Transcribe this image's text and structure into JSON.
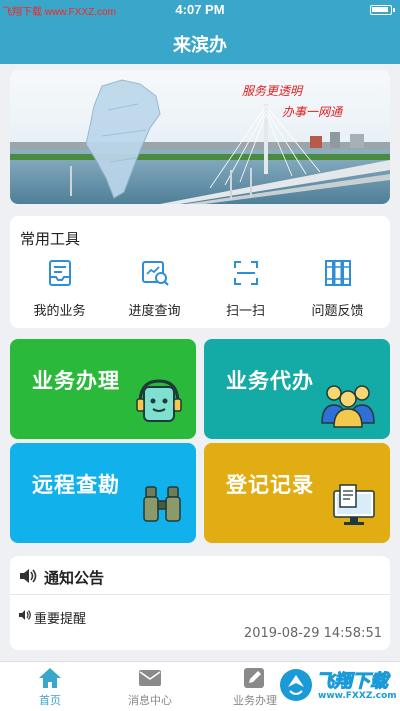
{
  "status_bar": {
    "watermark": "飞翔下载 www.FXXZ.com",
    "time": "4:07 PM"
  },
  "nav": {
    "title": "来滨办"
  },
  "banner": {
    "slogan_1": "服务更透明",
    "slogan_2": "办事一网通"
  },
  "tools": {
    "title": "常用工具",
    "items": [
      {
        "label": "我的业务",
        "icon": "inbox-icon"
      },
      {
        "label": "进度查询",
        "icon": "progress-search-icon"
      },
      {
        "label": "扫一扫",
        "icon": "scan-icon"
      },
      {
        "label": "问题反馈",
        "icon": "feedback-books-icon"
      }
    ]
  },
  "tiles": [
    {
      "label": "业务办理",
      "color": "#2ab93b",
      "icon": "headset-robot-icon"
    },
    {
      "label": "业务代办",
      "color": "#14aaa6",
      "icon": "team-people-icon"
    },
    {
      "label": "远程查勘",
      "color": "#11b1ec",
      "icon": "binoculars-icon"
    },
    {
      "label": "登记记录",
      "color": "#e2ad13",
      "icon": "computer-document-icon"
    }
  ],
  "notice": {
    "title": "通知公告",
    "item_title": "重要提醒",
    "item_date": "2019-08-29 14:58:51"
  },
  "tab_bar": {
    "tabs": [
      {
        "label": "首页",
        "icon": "home-icon",
        "active": true
      },
      {
        "label": "消息中心",
        "icon": "mail-icon",
        "active": false
      },
      {
        "label": "业务办理",
        "icon": "pencil-icon",
        "active": false
      }
    ]
  },
  "corner_watermark": {
    "text": "飞翔下载",
    "url": "www.FXXZ.com"
  },
  "colors": {
    "primary": "#3aa6c9",
    "accent_red": "#e02020"
  }
}
